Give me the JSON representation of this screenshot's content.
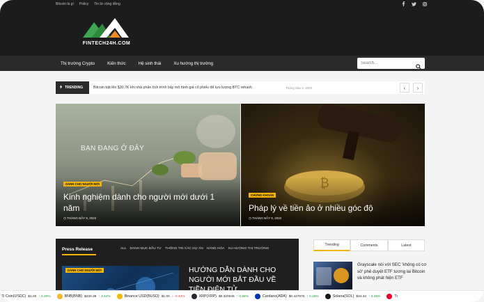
{
  "top_links": [
    "Bitcoin là gì",
    "Policy",
    "Tin từ cộng đồng"
  ],
  "logo": {
    "text": "FINTECH24H.COM"
  },
  "nav": {
    "items": [
      "Thị trường Crypto",
      "Kiến thức",
      "Hệ sinh thái",
      "Xu hướng thị trường"
    ]
  },
  "search": {
    "placeholder": "Search..."
  },
  "trending": {
    "label": "TRENDING",
    "headline": "Bitcoin bật lên $30,7K khi nhà phân tích trình bày mô hình giá cổ phiếu để lựu lượng BTC rehash",
    "date": "Tháng Sáu 3, 2022"
  },
  "featured": [
    {
      "overlay_text": "BẠN ĐANG Ở ĐÂY",
      "badge": "DÀNH CHO NGƯỜI MỚI",
      "title": "Kinh nghiệm dành cho người mới dưới 1 năm",
      "date": "THÁNG BẢY 9, 2022"
    },
    {
      "badge": "CHỨNG KHOÁN",
      "title": "Pháp lý về tiền ảo ở nhiều góc độ",
      "date": "THÁNG BẢY 9, 2022"
    }
  ],
  "press": {
    "title": "Press Release",
    "categories": [
      "ALL",
      "DANH MỤC ĐẦU TƯ",
      "THÔNG TIN CÁC DỰ ÁN",
      "HÀNG HÓA",
      "XU HƯỚNG THỊ TRƯỜNG"
    ],
    "badge": "DÀNH CHO NGƯỜI MỚI",
    "headline": "HƯỚNG DẪN DÀNH CHO NGƯỜI MỚI BẮT ĐẦU VỀ TIỀN ĐIỆN TỬ"
  },
  "tabs": [
    "Trending",
    "Comments",
    "Latest"
  ],
  "side_article": {
    "title": "Grayscale nói với SEC 'không có cơ sở' phê duyệt ETF tương lai Bitcoin và không phát hiện ETF"
  },
  "ticker": [
    {
      "name": "'SD Coin(USDC)",
      "price": "$1.00",
      "change": "↑ 0.30%",
      "dir": "up",
      "color": "#2775ca"
    },
    {
      "name": "BNB(BNB)",
      "price": "$230.39",
      "change": "↑ 2.44%",
      "dir": "up",
      "color": "#f3ba2f"
    },
    {
      "name": "Binance USD(BUSD)",
      "price": "$1.00",
      "change": "↓ -0.44%",
      "dir": "dn",
      "color": "#f0b90b"
    },
    {
      "name": "XRP(XRP)",
      "price": "$0.320045",
      "change": "↑ 0.68%",
      "dir": "up",
      "color": "#23292f"
    },
    {
      "name": "Cardano(ADA)",
      "price": "$0.427970",
      "change": "↑ 0.28%",
      "dir": "up",
      "color": "#0033ad"
    },
    {
      "name": "Solana(SOL)",
      "price": "$34.34",
      "change": "↑ 2.36%",
      "dir": "up",
      "color": "#14161a"
    },
    {
      "name": "Tr",
      "price": "",
      "change": "",
      "dir": "up",
      "color": "#ef0027"
    }
  ],
  "colors": {
    "accent": "#f4b400",
    "dark": "#1c1c1c",
    "nav": "#2b2b2b"
  }
}
